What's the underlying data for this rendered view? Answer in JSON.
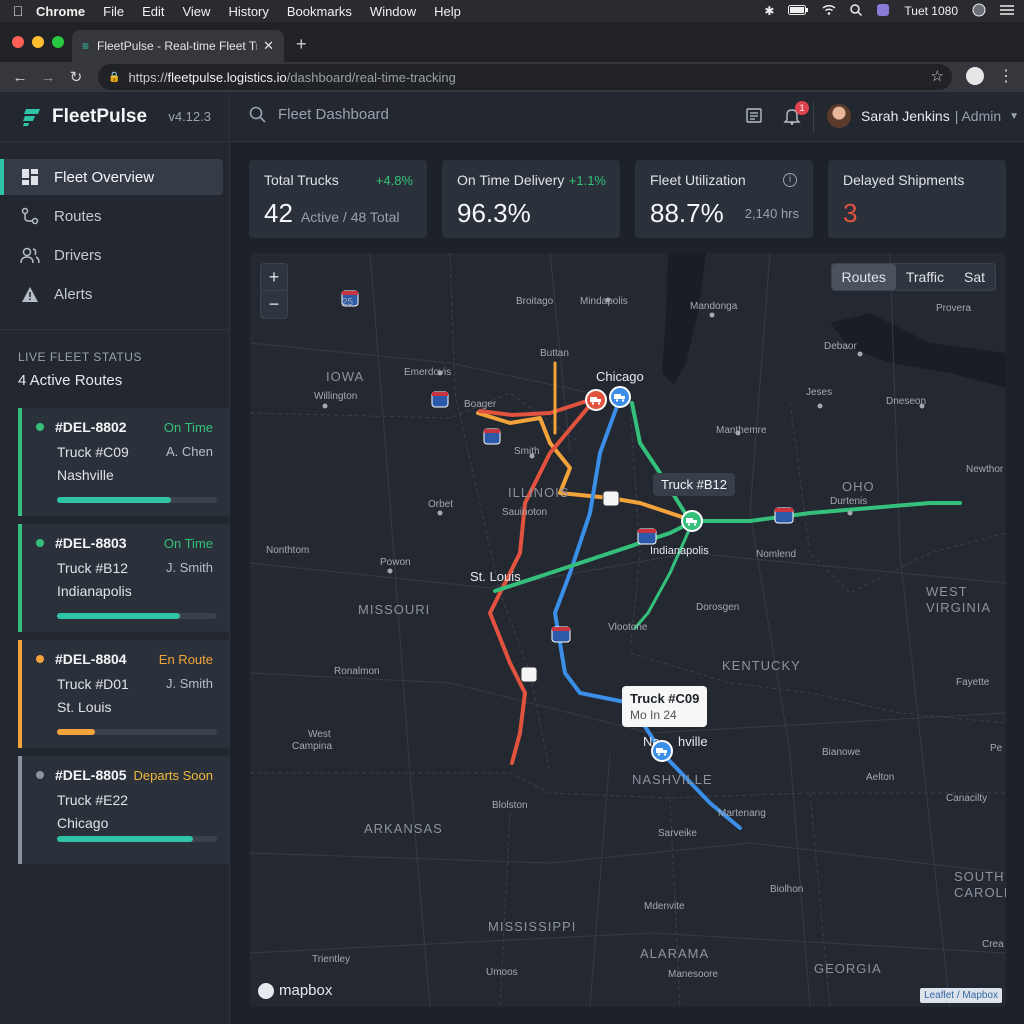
{
  "menubar": {
    "app": "Chrome",
    "items": [
      "File",
      "Edit",
      "View",
      "History",
      "Bookmarks",
      "Window",
      "Help"
    ],
    "clock": "Tuet 1080"
  },
  "browser": {
    "tab_title": "FleetPulse - Real-time Fleet Tr",
    "url_prefix": "https://",
    "url_host": "fleetpulse.logistics.io",
    "url_path": "/dashboard/real-time-tracking"
  },
  "app": {
    "name": "FleetPulse",
    "version": "v4.12.3"
  },
  "nav": {
    "items": [
      {
        "label": "Fleet Overview",
        "icon": "grid-icon"
      },
      {
        "label": "Routes",
        "icon": "route-icon"
      },
      {
        "label": "Drivers",
        "icon": "users-icon"
      },
      {
        "label": "Alerts",
        "icon": "warning-icon"
      }
    ]
  },
  "live_status": {
    "heading": "LIVE FLEET STATUS",
    "active_routes": "4 Active Routes",
    "routes": [
      {
        "id": "#DEL-8802",
        "status": "On Time",
        "status_color": "#34c07a",
        "truck": "Truck #C09",
        "driver": "A. Chen",
        "destination": "Nashville",
        "progress": 0.71
      },
      {
        "id": "#DEL-8803",
        "status": "On Time",
        "status_color": "#34c07a",
        "truck": "Truck #B12",
        "driver": "J. Smith",
        "destination": "Indianapolis",
        "progress": 0.77
      },
      {
        "id": "#DEL-8804",
        "status": "En Route",
        "status_color": "#f2a33a",
        "truck": "Truck #D01",
        "driver": "J. Smith",
        "destination": "St. Louis",
        "progress": 0.24
      },
      {
        "id": "#DEL-8805",
        "status": "Departs Soon",
        "status_color": "#f2b63a",
        "truck": "Truck #E22",
        "driver": "",
        "destination": "Chicago",
        "progress": 0.85
      }
    ]
  },
  "header": {
    "search_placeholder": "Fleet Dashboard",
    "notification_count": "1",
    "user_name": "Sarah Jenkins",
    "user_role": "| Admin"
  },
  "kpis": {
    "total_trucks": {
      "label": "Total Trucks",
      "delta": "+4.8%",
      "value": "42",
      "sub": "Active / 48 Total"
    },
    "on_time": {
      "label": "On Time Delivery",
      "delta": "+1.1%",
      "value": "96.3%"
    },
    "utilization": {
      "label": "Fleet Utilization",
      "value": "88.7%",
      "sub": "2,140 hrs"
    },
    "delayed": {
      "label": "Delayed Shipments",
      "value": "3"
    }
  },
  "map": {
    "toggles": [
      "Routes",
      "Traffic",
      "Sat"
    ],
    "active_toggle": "Routes",
    "states": [
      "IOWA",
      "ILLINOIS",
      "MISSOURI",
      "KENTUCKY",
      "ARKANSAS",
      "MISSISSIPPI",
      "ALARAMA",
      "GEORGIA",
      "OHO",
      "WEST",
      "VIRGINIA",
      "SOUTH",
      "CAROLINA",
      "NASHVILLE"
    ],
    "cities": [
      "Chicago",
      "St. Louis",
      "Indianapolis",
      "Na",
      "hville"
    ],
    "towns": [
      "Broitago",
      "Mindapolis",
      "Mandonga",
      "Debaor",
      "Provera",
      "Buttan",
      "Emerdovis",
      "Willington",
      "Boager",
      "Smith",
      "Jeses",
      "Dneseon",
      "Manthemre",
      "Newthor",
      "Durtenis",
      "Orbet",
      "Sauinoton",
      "Nonthtom",
      "Powon",
      "Nomlend",
      "Dorosgen",
      "Vlootone",
      "Ronalmon",
      "Fayette",
      "West",
      "Campina",
      "Bianowe",
      "Aelton",
      "Canacilty",
      "Pe",
      "Martenang",
      "Sarveike",
      "Blolston",
      "Biolhon",
      "Mdenvite",
      "Trientley",
      "Umoos",
      "Manesoore",
      "Crea"
    ],
    "highways": [
      "25",
      "23",
      "65",
      "23",
      "C0",
      "10",
      "20",
      "23"
    ],
    "tooltip_b12": "Truck #B12",
    "tooltip_c09_title": "Truck #C09",
    "tooltip_c09_sub": "Mo In 24",
    "route_colors": {
      "chicago_nashville": "#3b8fe8",
      "st_louis_ohio": "#34c07a",
      "orange": "#f2a33a",
      "red": "#e2533f"
    },
    "brand": "mapbox",
    "attribution": "Leaflet / Mapbox"
  }
}
